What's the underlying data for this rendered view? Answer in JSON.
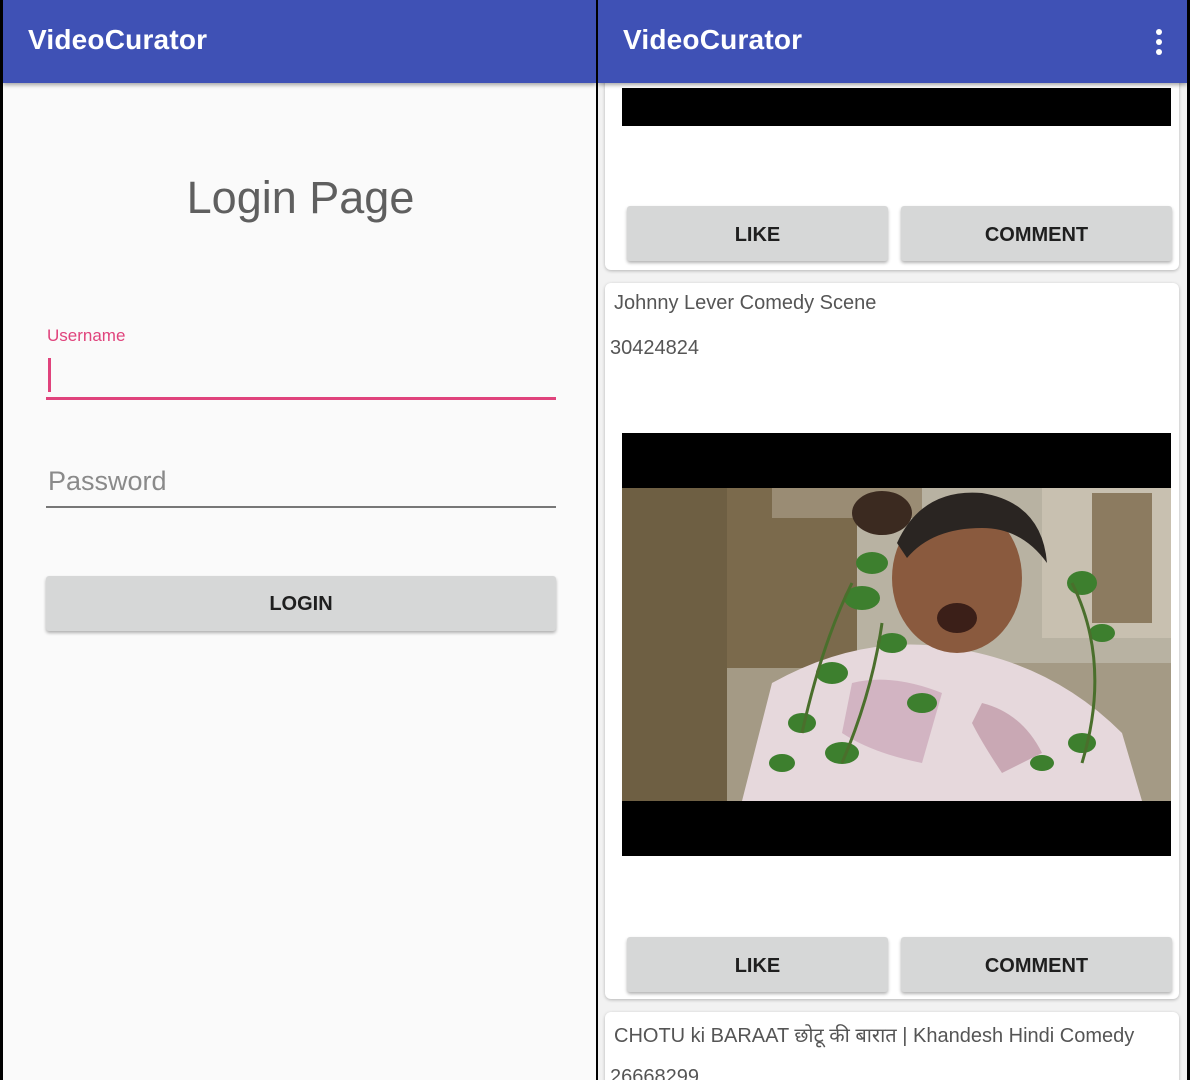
{
  "left_screen": {
    "app_title": "VideoCurator",
    "login_title": "Login Page",
    "username": {
      "label": "Username",
      "value": ""
    },
    "password": {
      "placeholder": "Password",
      "value": ""
    },
    "login_button": "LOGIN"
  },
  "right_screen": {
    "app_title": "VideoCurator",
    "menu_icon": "overflow-menu-icon",
    "videos": [
      {
        "title": "",
        "count": "",
        "like_label": "LIKE",
        "comment_label": "COMMENT"
      },
      {
        "title": "Johnny Lever Comedy Scene",
        "count": "30424824",
        "thumbnail": "comedy-scene-thumbnail",
        "like_label": "LIKE",
        "comment_label": "COMMENT"
      },
      {
        "title": "CHOTU ki BARAAT छोटू की बारात | Khandesh Hindi Comedy",
        "count": "26668299"
      }
    ]
  },
  "colors": {
    "app_bar": "#3f51b5",
    "accent": "#e0437c",
    "button": "#d6d7d7"
  }
}
